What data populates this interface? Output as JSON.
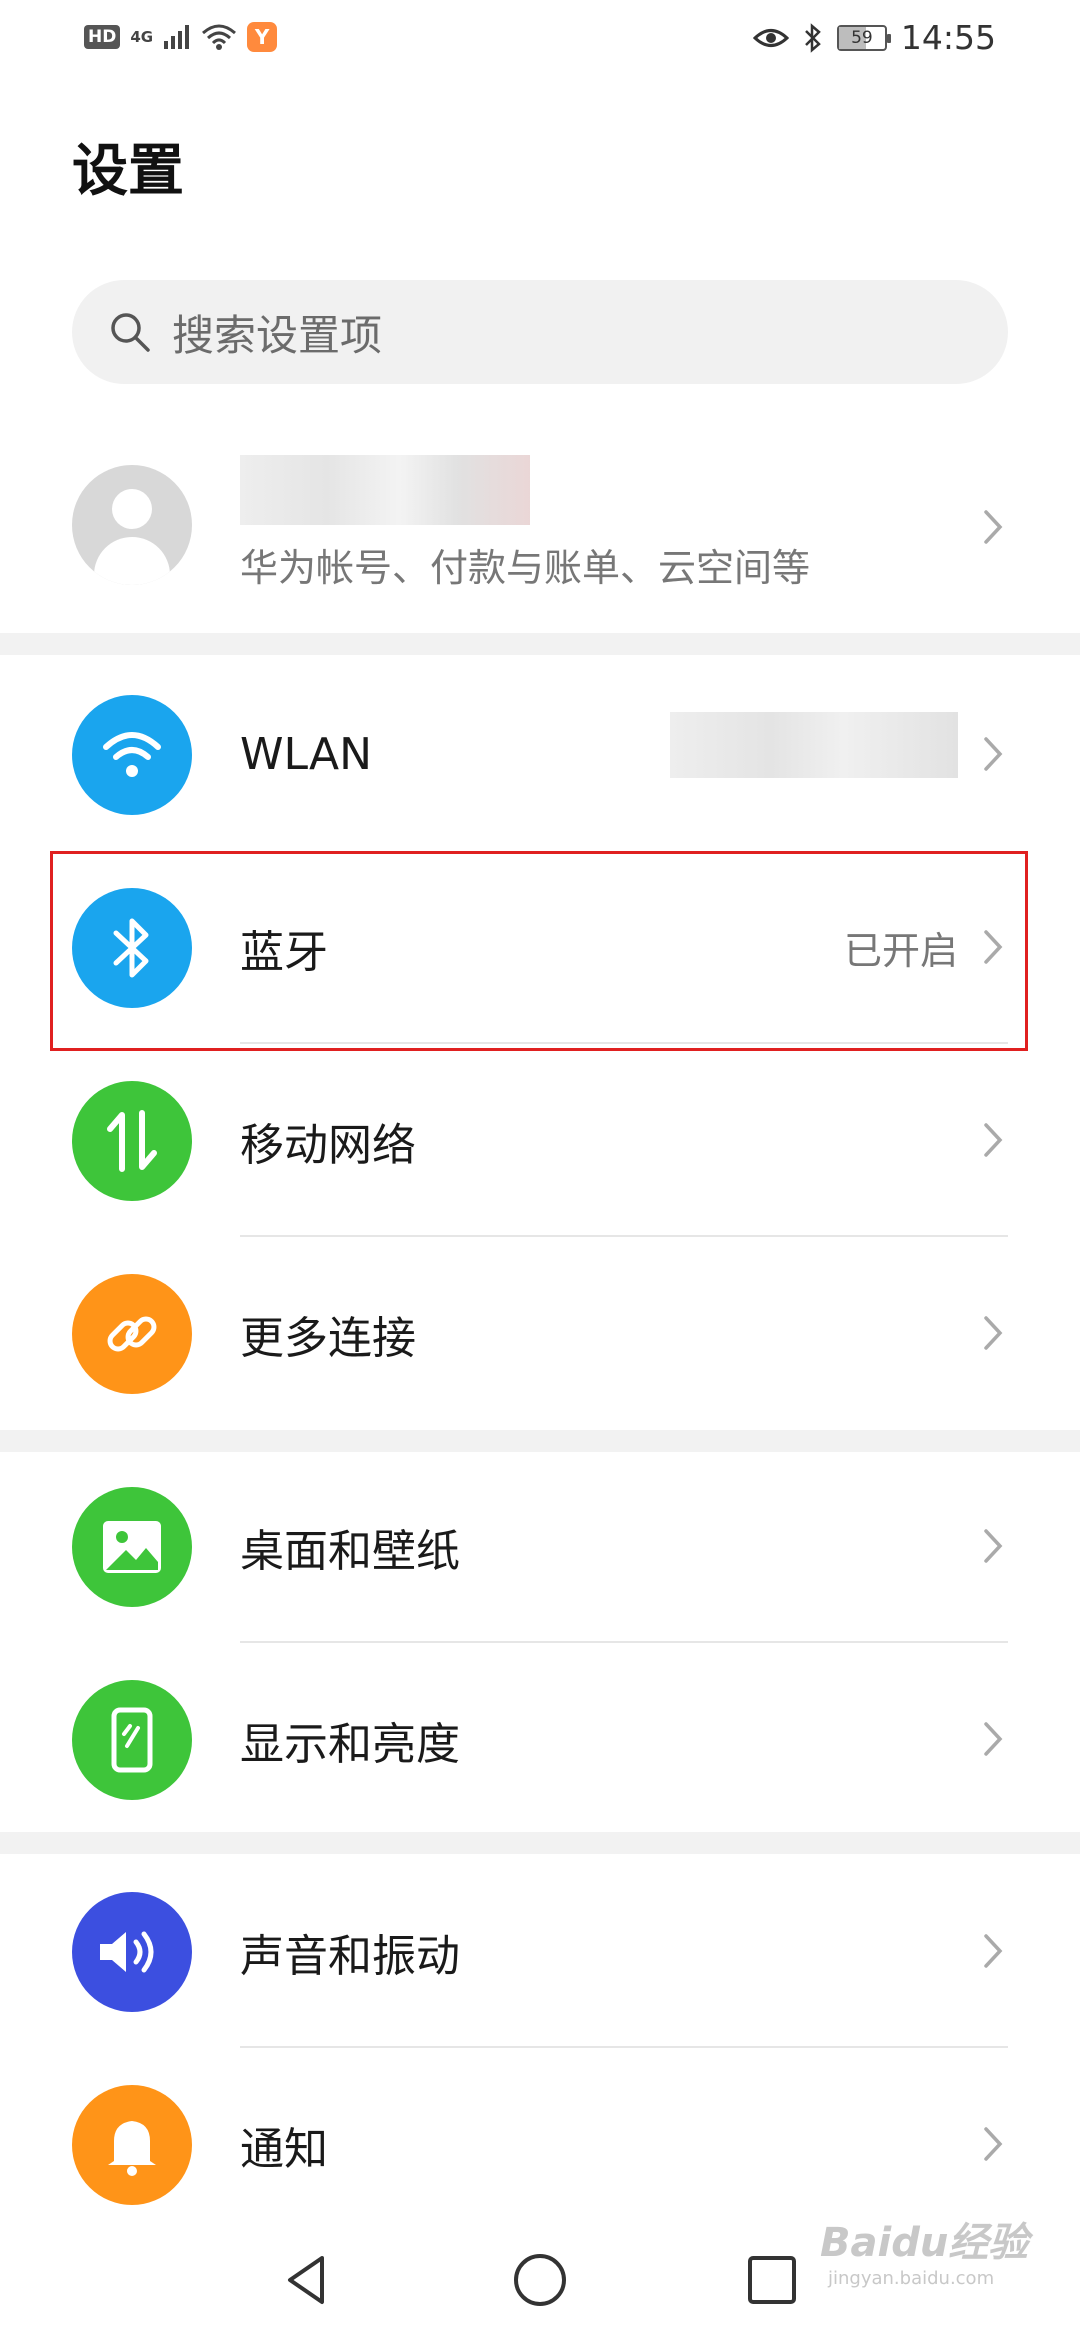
{
  "status_bar": {
    "hd": "HD",
    "network": "4G",
    "app_badge": "Y",
    "battery": "59",
    "battery_level": 0.59,
    "time": "14:55"
  },
  "header": {
    "title": "设置"
  },
  "search": {
    "placeholder": "搜索设置项"
  },
  "account": {
    "subtitle": "华为帐号、付款与账单、云空间等"
  },
  "groups": [
    [
      {
        "label": "WLAN",
        "icon": "wifi-icon",
        "color": "#1aa5ee"
      },
      {
        "label": "蓝牙",
        "value": "已开启",
        "icon": "bluetooth-icon",
        "color": "#1aa5ee"
      },
      {
        "label": "移动网络",
        "icon": "mobile-data-icon",
        "color": "#3ec53a"
      },
      {
        "label": "更多连接",
        "icon": "link-icon",
        "color": "#ff9418"
      }
    ],
    [
      {
        "label": "桌面和壁纸",
        "icon": "wallpaper-icon",
        "color": "#3ec53a"
      },
      {
        "label": "显示和亮度",
        "icon": "display-icon",
        "color": "#3ec53a"
      }
    ],
    [
      {
        "label": "声音和振动",
        "icon": "sound-icon",
        "color": "#3c4fe0"
      },
      {
        "label": "通知",
        "icon": "bell-icon",
        "color": "#ff9418"
      }
    ]
  ],
  "watermark": {
    "brand": "Baidu经验",
    "url": "jingyan.baidu.com"
  }
}
